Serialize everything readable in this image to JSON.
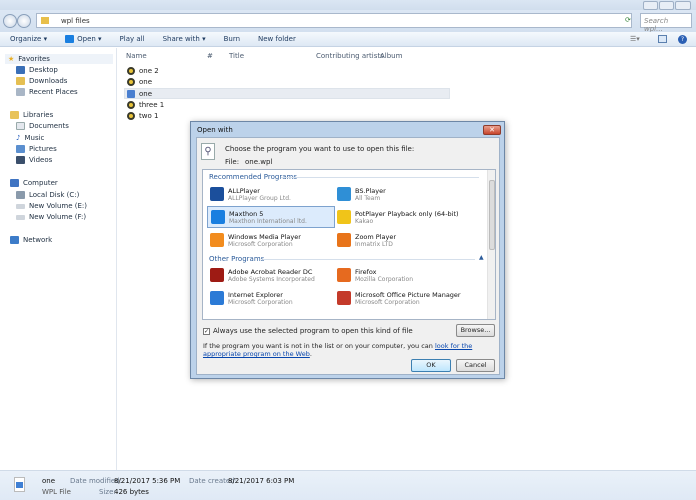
{
  "window": {
    "address": "wpl files",
    "search_placeholder": "Search wpl..."
  },
  "toolbar": {
    "organize": "Organize ▾",
    "open": "Open ▾",
    "play_all": "Play all",
    "share_with": "Share with ▾",
    "burn": "Burn",
    "new_folder": "New folder"
  },
  "sidebar": {
    "favorites": "Favorites",
    "desktop": "Desktop",
    "downloads": "Downloads",
    "recent": "Recent Places",
    "libraries": "Libraries",
    "documents": "Documents",
    "music": "Music",
    "pictures": "Pictures",
    "videos": "Videos",
    "computer": "Computer",
    "c": "Local Disk (C:)",
    "e": "New Volume (E:)",
    "f": "New Volume (F:)",
    "network": "Network"
  },
  "columns": [
    "Name",
    "#",
    "Title",
    "Contributing artists",
    "Album"
  ],
  "files": [
    "one 2",
    "one",
    "one",
    "three 1",
    "two 1"
  ],
  "dialog": {
    "title": "Open with",
    "prompt": "Choose the program you want to use to open this file:",
    "file_label": "File:",
    "file_name": "one.wpl",
    "recommended_header": "Recommended Programs",
    "other_header": "Other Programs",
    "recommended": [
      {
        "name": "ALLPlayer",
        "company": "ALLPlayer Group Ltd.",
        "color": "#1b4f9c"
      },
      {
        "name": "BS.Player",
        "company": "All Team",
        "color": "#2f8fd6"
      },
      {
        "name": "Maxthon 5",
        "company": "Maxthon International ltd.",
        "color": "#1a7fe0"
      },
      {
        "name": "PotPlayer Playback only (64-bit)",
        "company": "Kakao",
        "color": "#f0c419"
      },
      {
        "name": "Windows Media Player",
        "company": "Microsoft Corporation",
        "color": "#f28c1e"
      },
      {
        "name": "Zoom Player",
        "company": "Inmatrix LTD",
        "color": "#e8741a"
      }
    ],
    "other": [
      {
        "name": "Adobe Acrobat Reader DC",
        "company": "Adobe Systems Incorporated",
        "color": "#9e1b14"
      },
      {
        "name": "Firefox",
        "company": "Mozilla Corporation",
        "color": "#e66a1f"
      },
      {
        "name": "Internet Explorer",
        "company": "Microsoft Corporation",
        "color": "#2b7ad6"
      },
      {
        "name": "Microsoft Office Picture Manager",
        "company": "Microsoft Corporation",
        "color": "#c43a2a"
      }
    ],
    "always_use": "Always use the selected program to open this kind of file",
    "always_checked": true,
    "browse": "Browse...",
    "help_text": "If the program you want is not in the list or on your computer, you can",
    "help_link": "look for the appropriate program on the Web",
    "ok": "OK",
    "cancel": "Cancel"
  },
  "status": {
    "name": "one",
    "type": "WPL File",
    "modified_label": "Date modified:",
    "modified": "8/21/2017 5:36 PM",
    "created_label": "Date created:",
    "created": "8/21/2017 6:03 PM",
    "size_label": "Size:",
    "size": "426 bytes"
  }
}
